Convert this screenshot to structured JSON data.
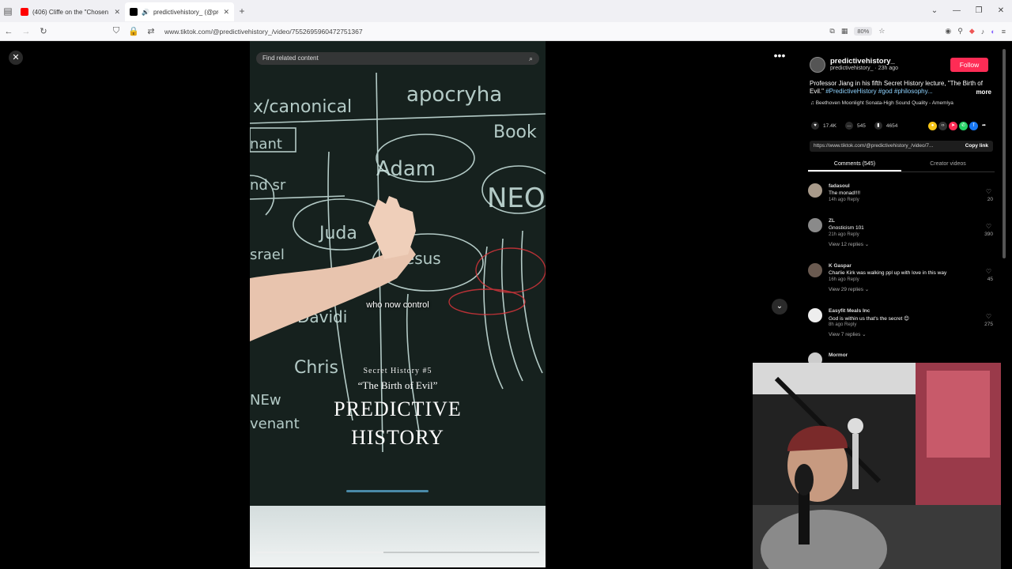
{
  "browser": {
    "tabs": [
      {
        "title": "(406) Cliffe on the \"Chosen Peo",
        "icon_color": "#ff0000",
        "active": false
      },
      {
        "title": "predictivehistory_ (@predi",
        "icon_color": "#000000",
        "active": true
      }
    ],
    "new_tab": "+",
    "url": "www.tiktok.com/@predictivehistory_/video/7552695960472751367",
    "zoom": "80%"
  },
  "video": {
    "search_placeholder": "Find related content",
    "caption": "who now control",
    "overlay_small": "Secret History #5",
    "overlay_quote": "“The Birth of Evil”",
    "overlay_title_1": "PREDICTIVE",
    "overlay_title_2": "HISTORY",
    "progress": 0.45
  },
  "panel": {
    "username": "predictivehistory_",
    "meta": "predictivehistory_ · 23h ago",
    "follow_label": "Follow",
    "description": "Professor Jiang in his fifth Secret History lecture, \"The Birth of Evil.\" ",
    "tags": "#PredictiveHistory #god #philosophy...",
    "more_label": "more",
    "music": "Beethoven Moonlight Sonata-High Sound Quality - Amemlya",
    "stats": {
      "likes": "17.4K",
      "comments": "545",
      "saves": "4654"
    },
    "link": "https://www.tiktok.com/@predictivehistory_/video/7...",
    "copy_label": "Copy link",
    "tab_comments": "Comments (545)",
    "tab_creator": "Creator videos",
    "comments": [
      {
        "name": "fadasoul",
        "text": "The monad!!!!",
        "meta": "14h ago    Reply",
        "likes": "20",
        "replies": ""
      },
      {
        "name": "ZL",
        "text": "Gnosticism 101",
        "meta": "21h ago    Reply",
        "likes": "390",
        "replies": "View 12 replies ⌄"
      },
      {
        "name": "K Gaspar",
        "text": "Charlie Kirk was walking ppl up with love in this way",
        "meta": "16h ago    Reply",
        "likes": "45",
        "replies": "View 29 replies ⌄"
      },
      {
        "name": "Easyfit Meals Inc",
        "text": "God is within us that's the secret 😊",
        "meta": "8h ago    Reply",
        "likes": "275",
        "replies": "View 7 replies ⌄"
      },
      {
        "name": "Mormor",
        "text": "",
        "meta": "",
        "likes": "",
        "replies": ""
      }
    ]
  },
  "colors": {
    "follow": "#fe2c55",
    "board": "#16211e",
    "tag": "#8fd3ff"
  }
}
